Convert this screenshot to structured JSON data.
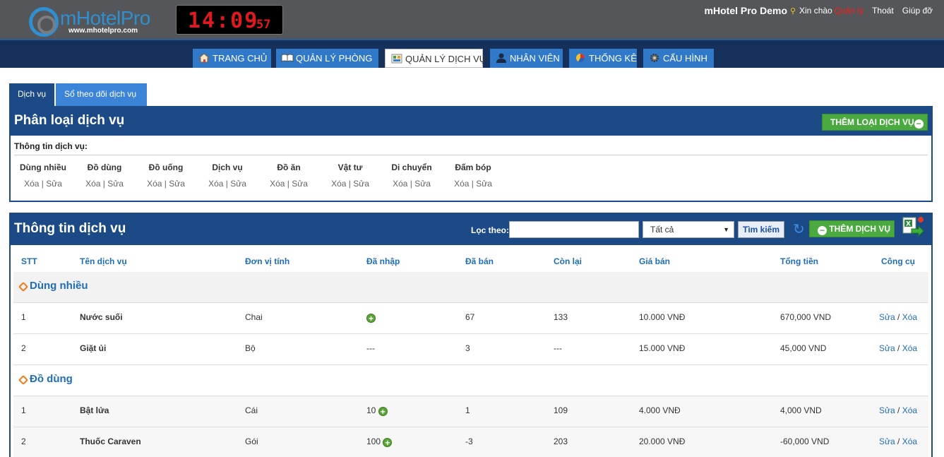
{
  "header": {
    "logo_text": "mHotelPro",
    "logo_url": "www.mhotelpro.com",
    "clock": {
      "main": "14:09",
      "seconds": "57"
    },
    "brand": "mHotel Pro Demo",
    "greeting": "Xin chào",
    "user": "Quản lý",
    "links": [
      "Thoát",
      "Giúp đỡ"
    ]
  },
  "nav": [
    {
      "label": "TRANG CHỦ",
      "icon": "home-icon",
      "active": false
    },
    {
      "label": "QUẢN LÝ PHÒNG",
      "icon": "book-icon",
      "active": false
    },
    {
      "label": "QUẢN LÝ DỊCH VỤ",
      "icon": "service-icon",
      "active": true
    },
    {
      "label": "NHÂN VIÊN",
      "icon": "user-icon",
      "active": false
    },
    {
      "label": "THỐNG KÊ",
      "icon": "pie-chart-icon",
      "active": false
    },
    {
      "label": "CẤU HÌNH",
      "icon": "gear-icon",
      "active": false
    }
  ],
  "tabs": [
    "Dịch vụ",
    "Sổ theo dõi dịch vụ"
  ],
  "category_panel": {
    "title": "Phân loại dịch vụ",
    "add_button": "THÊM LOẠI DỊCH VỤ",
    "info_label": "Thông tin dịch vụ:",
    "categories": [
      "Dùng nhiều",
      "Đồ dùng",
      "Đồ uống",
      "Dịch vụ",
      "Đồ ăn",
      "Vật tư",
      "Di chuyển",
      "Đấm bóp"
    ],
    "actions": "Xóa | Sửa"
  },
  "service_panel": {
    "title": "Thông tin dịch vụ",
    "filter_label": "Lọc theo:",
    "filter_value": "",
    "select_value": "Tất cả",
    "search_button": "Tìm kiếm",
    "add_button": "THÊM DỊCH VỤ",
    "columns": [
      "STT",
      "Tên dịch vụ",
      "Đơn vị tính",
      "Đã nhập",
      "Đã bán",
      "Còn lại",
      "Giá bán",
      "Tổng tiền",
      "Công cụ"
    ],
    "groups": [
      {
        "name": "Dùng nhiều",
        "rows": [
          {
            "stt": "1",
            "name": "Nước suối",
            "unit": "Chai",
            "imported": "",
            "sold": "67",
            "remaining": "133",
            "price": "10.000 VNĐ",
            "total": "670,000 VND",
            "edit": "Sửa",
            "delete": "Xóa"
          },
          {
            "stt": "2",
            "name": "Giặt ủi",
            "unit": "Bộ",
            "imported": "---",
            "sold": "3",
            "remaining": "---",
            "price": "15.000 VNĐ",
            "total": "45,000 VND",
            "edit": "Sửa",
            "delete": "Xóa"
          }
        ]
      },
      {
        "name": "Đồ dùng",
        "rows": [
          {
            "stt": "1",
            "name": "Bật lửa",
            "unit": "Cái",
            "imported": "10",
            "sold": "1",
            "remaining": "109",
            "price": "4.000 VNĐ",
            "total": "4,000 VND",
            "edit": "Sửa",
            "delete": "Xóa"
          },
          {
            "stt": "2",
            "name": "Thuốc Caraven",
            "unit": "Gói",
            "imported": "100",
            "sold": "-3",
            "remaining": "203",
            "price": "20.000 VNĐ",
            "total": "-60,000 VND",
            "edit": "Sửa",
            "delete": "Xóa"
          }
        ]
      }
    ]
  }
}
